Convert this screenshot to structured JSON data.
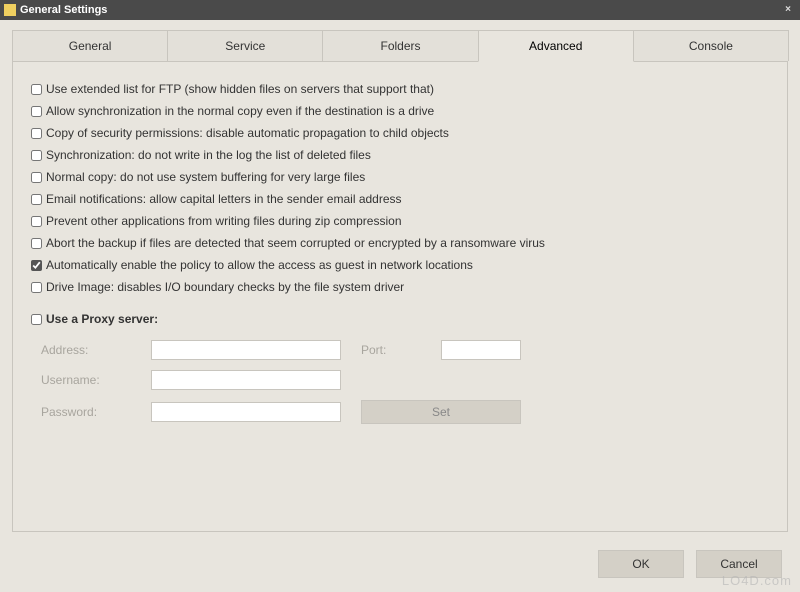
{
  "window": {
    "title": "General Settings",
    "close": "×"
  },
  "tabs": {
    "general": "General",
    "service": "Service",
    "folders": "Folders",
    "advanced": "Advanced",
    "console": "Console"
  },
  "options": [
    {
      "label": "Use extended list for FTP (show hidden files on servers that support that)",
      "checked": false
    },
    {
      "label": "Allow synchronization in the normal copy even if the destination is a drive",
      "checked": false
    },
    {
      "label": "Copy of security permissions: disable automatic propagation to child objects",
      "checked": false
    },
    {
      "label": "Synchronization: do not write in the log the list of deleted files",
      "checked": false
    },
    {
      "label": "Normal copy: do not use system buffering for very large files",
      "checked": false
    },
    {
      "label": "Email notifications: allow capital letters in the sender email address",
      "checked": false
    },
    {
      "label": "Prevent other applications from writing files during zip compression",
      "checked": false
    },
    {
      "label": "Abort the backup if files are detected that seem corrupted or encrypted by a ransomware virus",
      "checked": false
    },
    {
      "label": "Automatically enable the policy to allow the access as guest in network locations",
      "checked": true
    },
    {
      "label": "Drive Image: disables I/O boundary checks by the file system driver",
      "checked": false
    }
  ],
  "proxy": {
    "use_label": "Use a Proxy server:",
    "use_checked": false,
    "address_label": "Address:",
    "address_value": "",
    "port_label": "Port:",
    "port_value": "",
    "username_label": "Username:",
    "username_value": "",
    "password_label": "Password:",
    "password_value": "",
    "set_label": "Set"
  },
  "footer": {
    "ok": "OK",
    "cancel": "Cancel"
  },
  "watermark": "LO4D.com"
}
